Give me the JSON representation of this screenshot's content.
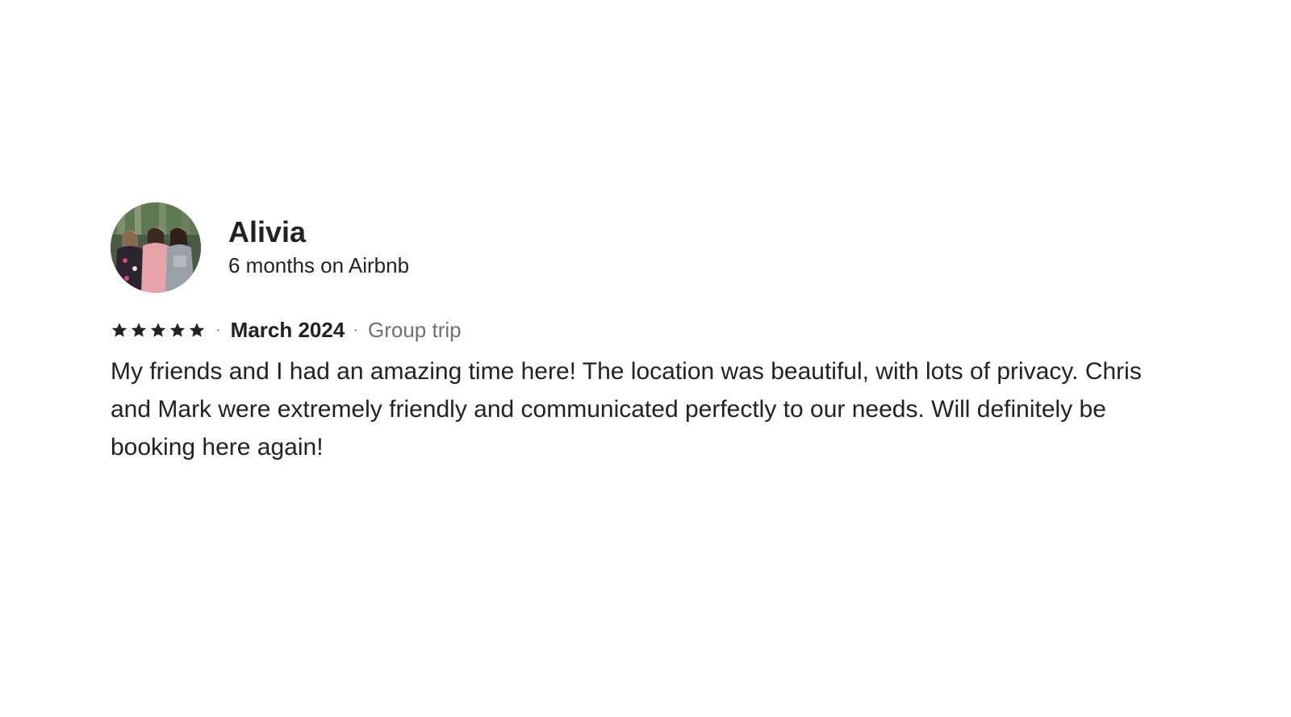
{
  "review": {
    "reviewer": {
      "name": "Alivia",
      "tenure": "6 months on Airbnb",
      "avatar_alt": "avatar"
    },
    "rating": 5,
    "rating_max": 5,
    "star_icon": "star-icon",
    "separator": "·",
    "date": "March 2024",
    "trip_type": "Group trip",
    "text": "My friends and I had an amazing time here! The location was beautiful, with lots of privacy. Chris and Mark were extremely friendly and communicated perfectly to our needs. Will definitely be booking here again!"
  },
  "colors": {
    "text_primary": "#222222",
    "text_secondary": "#717171",
    "star": "#222222",
    "background": "#ffffff"
  }
}
